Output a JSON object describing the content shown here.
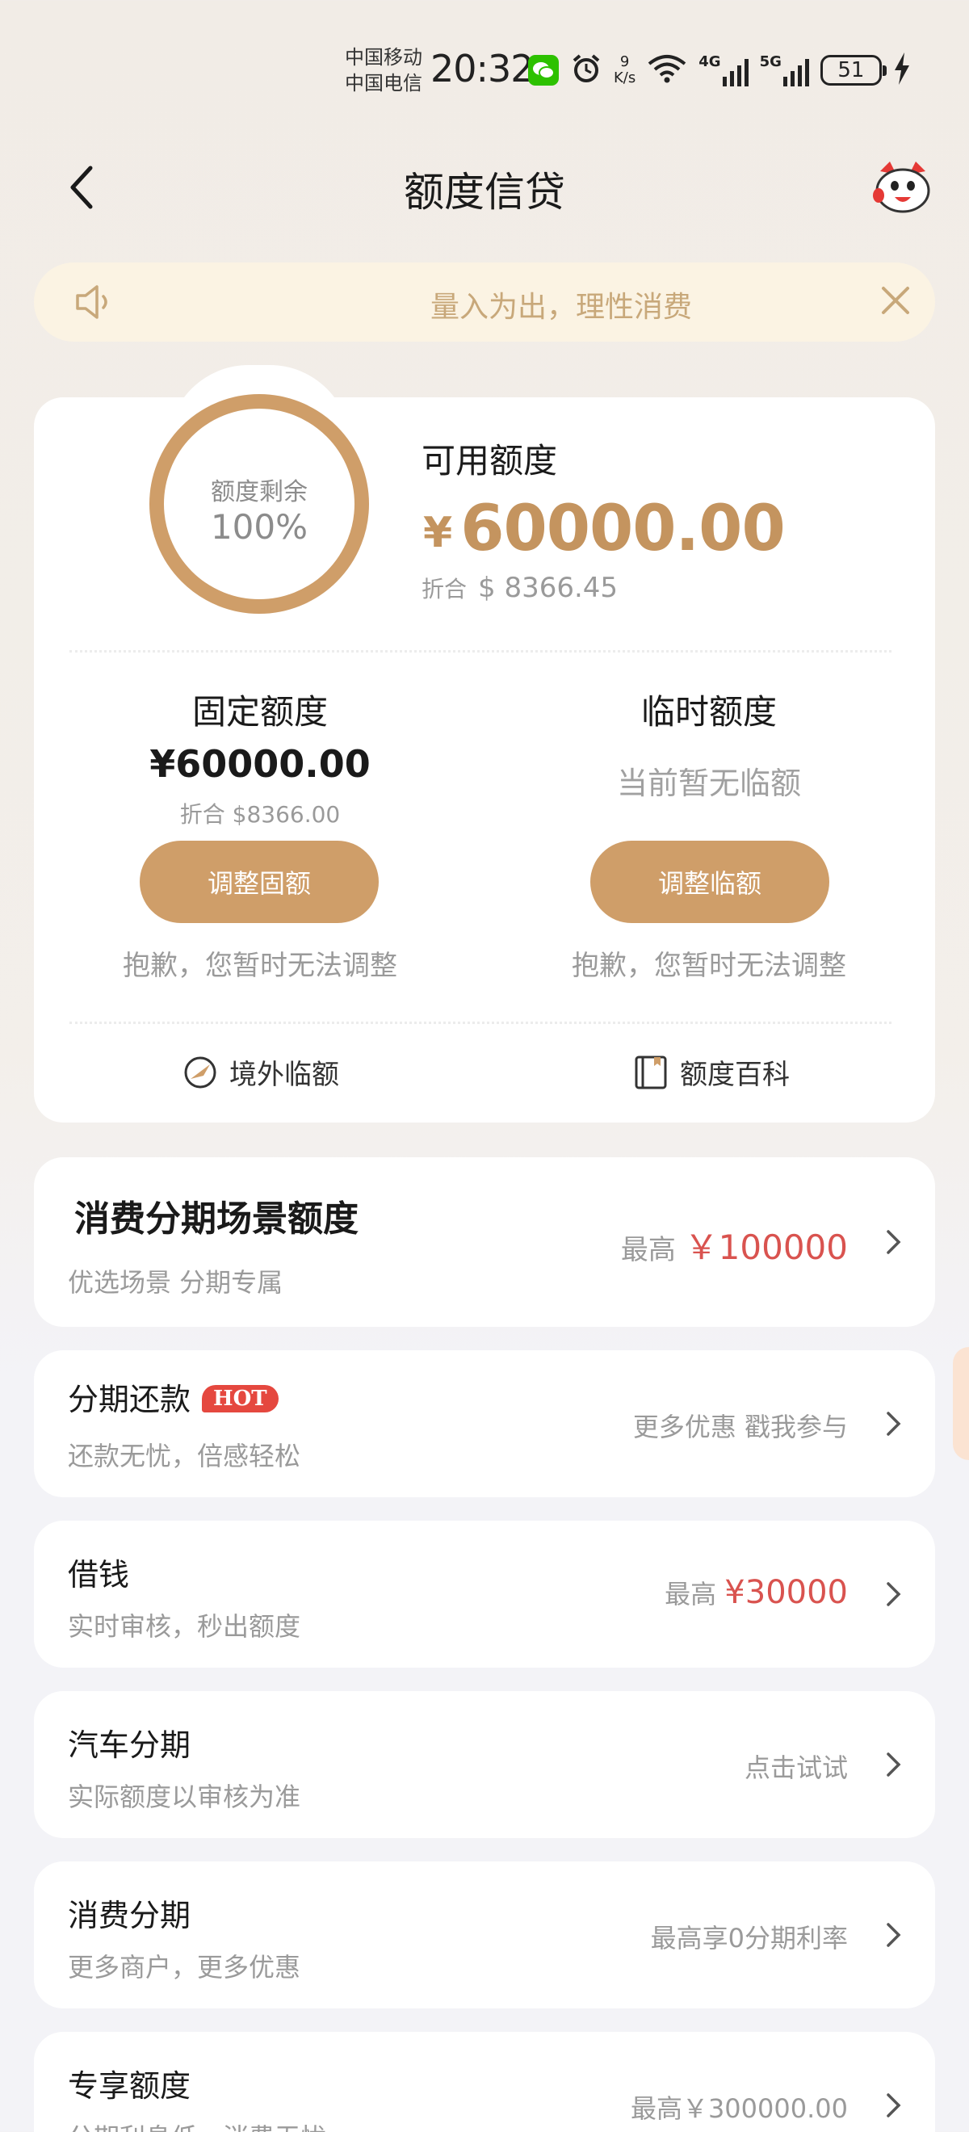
{
  "status_bar": {
    "carrier1": "中国移动",
    "carrier2": "中国电信",
    "time": "20:32",
    "net_speed_value": "9",
    "net_speed_unit": "K/s",
    "signal1": "4G",
    "signal2": "5G",
    "battery": "51",
    "icons": [
      "wechat-icon",
      "alarm-icon",
      "wifi-icon",
      "signal-4g-icon",
      "signal-5g-icon",
      "battery-icon",
      "charging-icon"
    ]
  },
  "header": {
    "title": "额度信贷",
    "back_icon": "chevron-left-icon",
    "mascot_icon": "mascot-icon"
  },
  "notice": {
    "text": "量入为出，理性消费",
    "icons": [
      "speaker-icon",
      "close-icon"
    ]
  },
  "credit": {
    "ring_label": "额度剩余",
    "ring_value": "100%",
    "ring_fraction": 1.0,
    "available_label": "可用额度",
    "available_currency": "¥",
    "available_amount": "60000.00",
    "converted_prefix": "折合",
    "converted_amount": "$ 8366.45",
    "accent_color": "#cf9e69"
  },
  "fixed": {
    "title": "固定额度",
    "amount": "¥60000.00",
    "converted": "折合 $8366.00",
    "button": "调整固额",
    "note": "抱歉，您暂时无法调整"
  },
  "temporary": {
    "title": "临时额度",
    "status": "当前暂无临额",
    "button": "调整临额",
    "note": "抱歉，您暂时无法调整"
  },
  "quick_links": [
    {
      "label": "境外临额",
      "icon": "overseas-icon"
    },
    {
      "label": "额度百科",
      "icon": "book-icon"
    }
  ],
  "scene": {
    "title": "消费分期场景额度",
    "subtitle": "优选场景 分期专属",
    "right_prefix": "最高",
    "right_value": "￥100000"
  },
  "rows": [
    {
      "title": "分期还款",
      "badge": "HOT",
      "subtitle": "还款无忧，倍感轻松",
      "right_prefix": "更多优惠 戳我参与",
      "right_value": ""
    },
    {
      "title": "借钱",
      "badge": "",
      "subtitle": "实时审核，秒出额度",
      "right_prefix": "最高 ",
      "right_value": "¥30000"
    },
    {
      "title": "汽车分期",
      "badge": "",
      "subtitle": "实际额度以审核为准",
      "right_prefix": "点击试试",
      "right_value": ""
    },
    {
      "title": "消费分期",
      "badge": "",
      "subtitle": "更多商户，更多优惠",
      "right_prefix": "最高享0分期利率",
      "right_value": ""
    },
    {
      "title": "专享额度",
      "badge": "",
      "subtitle": "分期利息低，消费无忧",
      "right_prefix": "最高￥300000.00",
      "right_value": ""
    }
  ]
}
